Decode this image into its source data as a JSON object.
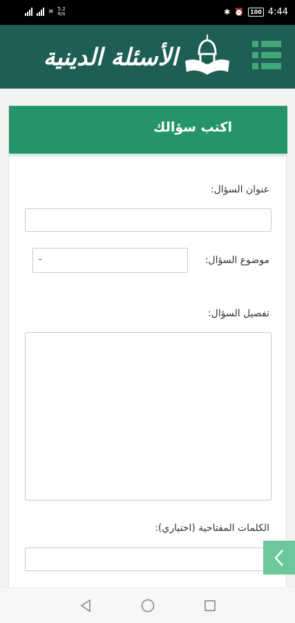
{
  "status_bar": {
    "network_speed_value": "5.2",
    "network_speed_unit": "K/s",
    "battery": "100",
    "time": "4:44"
  },
  "app": {
    "logo_text": "الأسئلة الدينية",
    "brand_color": "#1f5e55",
    "accent_color": "#26946a"
  },
  "form": {
    "title": "اكتب سؤالك",
    "question_title_label": "عنوان السؤال:",
    "question_title_value": "",
    "topic_label": "موضوع السؤال:",
    "topic_selected": "",
    "details_label": "تفصيل السؤال:",
    "details_value": "",
    "keywords_label": "الكلمات المفتاحية (اختياري):",
    "keywords_value": ""
  },
  "icons": {
    "menu": "menu-grid-icon",
    "logo": "mosque-book-icon",
    "side_tab": "chevron-left-icon",
    "nav_back": "triangle-back-icon",
    "nav_home": "circle-home-icon",
    "nav_recents": "square-recents-icon"
  }
}
